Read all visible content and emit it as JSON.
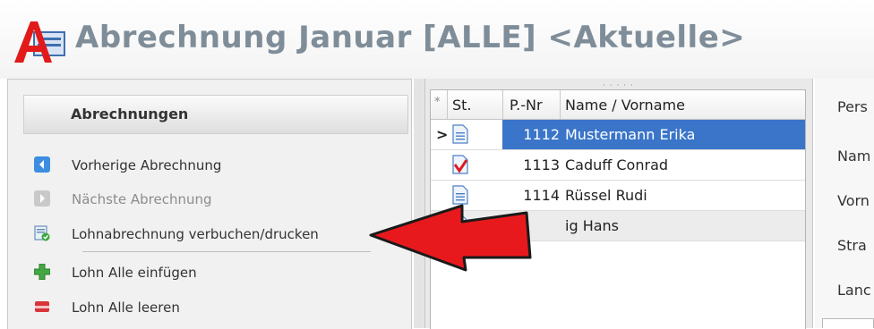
{
  "window": {
    "title": "Abrechnung Januar [ALLE] <Aktuelle>"
  },
  "left_panel": {
    "header": "Abrechnungen",
    "items": [
      {
        "label": "Vorherige Abrechnung",
        "icon": "arrow-left-icon",
        "enabled": true
      },
      {
        "label": "Nächste Abrechnung",
        "icon": "arrow-right-icon",
        "enabled": false
      },
      {
        "label": "Lohnabrechnung verbuchen/drucken",
        "icon": "book-print-icon",
        "enabled": true
      },
      {
        "label": "Lohn Alle einfügen",
        "icon": "plus-icon",
        "enabled": true
      },
      {
        "label": "Lohn Alle leeren",
        "icon": "eraser-icon",
        "enabled": true
      }
    ]
  },
  "grid": {
    "columns": {
      "filter": "*",
      "status": "St.",
      "number": "P.-Nr",
      "name": "Name / Vorname"
    },
    "rows": [
      {
        "number": "1112",
        "name": "Mustermann Erika",
        "selected": true,
        "status_icon": "document-icon"
      },
      {
        "number": "1113",
        "name": "Caduff Conrad",
        "selected": false,
        "status_icon": "document-checked-icon"
      },
      {
        "number": "1114",
        "name": "Rüssel Rudi",
        "selected": false,
        "status_icon": "document-icon"
      },
      {
        "number": "",
        "name": "ig Hans",
        "selected": false,
        "status_icon": "document-icon"
      }
    ],
    "current_row_marker": ">"
  },
  "form": {
    "labels": [
      "Pers",
      "Nam",
      "Vorn",
      "Stra",
      "Lanc"
    ]
  },
  "colors": {
    "selection": "#3a75c9",
    "title": "#7f8d99",
    "arrow": "#e8191d"
  }
}
